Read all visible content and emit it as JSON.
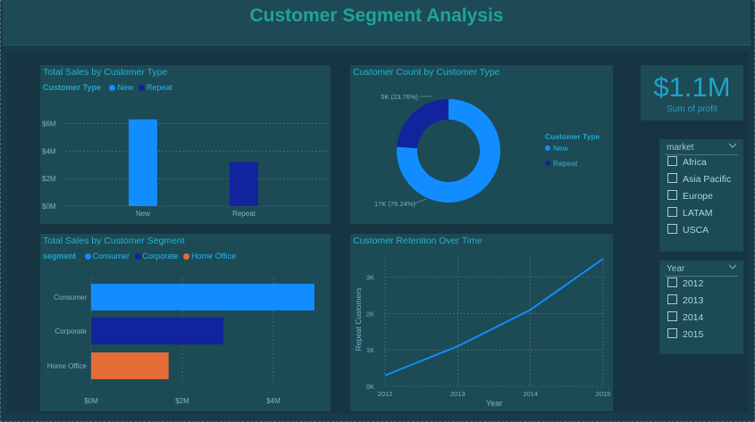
{
  "header": {
    "title": "Customer Segment Analysis"
  },
  "panels": {
    "sales_by_type": {
      "title": "Total Sales by Customer Type",
      "legend_title": "Customer Type",
      "legend": [
        "New",
        "Repeat"
      ]
    },
    "count_by_type": {
      "title": "Customer Count by Customer Type",
      "legend_title": "Customer Type",
      "legend": [
        "New",
        "Repeat"
      ],
      "label_repeat": "5K (23.76%)",
      "label_new": "17K (76.24%)"
    },
    "sales_by_segment": {
      "title": "Total Sales by Customer Segment",
      "legend_title": "segment",
      "legend": [
        "Consumer",
        "Corporate",
        "Home Office"
      ]
    },
    "retention": {
      "title": "Customer Retention Over Time"
    }
  },
  "kpi": {
    "value": "$1.1M",
    "label": "Sum of profit"
  },
  "slicers": {
    "market": {
      "title": "market",
      "items": [
        "Africa",
        "Asia Pacific",
        "Europe",
        "LATAM",
        "USCA"
      ]
    },
    "year": {
      "title": "Year",
      "items": [
        "2012",
        "2013",
        "2014",
        "2015"
      ]
    }
  },
  "colors": {
    "new": "#118dff",
    "repeat": "#12239e",
    "home_office": "#e66c37",
    "teal_title": "#1fa39a",
    "panel": "#1c4a55"
  },
  "chart_data": [
    {
      "type": "bar",
      "title": "Total Sales by Customer Type",
      "categories": [
        "New",
        "Repeat"
      ],
      "values": [
        6.3,
        3.2
      ],
      "value_unit": "M",
      "yticks": [
        "$0M",
        "$2M",
        "$4M",
        "$6M"
      ],
      "ylim": [
        0,
        7
      ],
      "legend_position": "top-left",
      "grid": true
    },
    {
      "type": "pie",
      "title": "Customer Count by Customer Type",
      "categories": [
        "New",
        "Repeat"
      ],
      "values": [
        76.24,
        23.76
      ],
      "legend_position": "right"
    },
    {
      "type": "bar",
      "orientation": "horizontal",
      "title": "Total Sales by Customer Segment",
      "categories": [
        "Consumer",
        "Corporate",
        "Home Office"
      ],
      "values": [
        4.9,
        2.9,
        1.7
      ],
      "value_unit": "M",
      "xticks": [
        "$0M",
        "$2M",
        "$4M"
      ],
      "xlim": [
        0,
        5
      ],
      "legend_position": "top-left",
      "grid": true
    },
    {
      "type": "line",
      "title": "Customer Retention Over Time",
      "x": [
        "2012",
        "2013",
        "2014",
        "2015"
      ],
      "values": [
        0.3,
        1.1,
        2.1,
        3.5
      ],
      "value_unit": "K",
      "yticks": [
        "0K",
        "1K",
        "2K",
        "3K"
      ],
      "ylim": [
        0,
        3.6
      ],
      "xlabel": "Year",
      "ylabel": "Repeat Customers",
      "grid": true
    }
  ]
}
